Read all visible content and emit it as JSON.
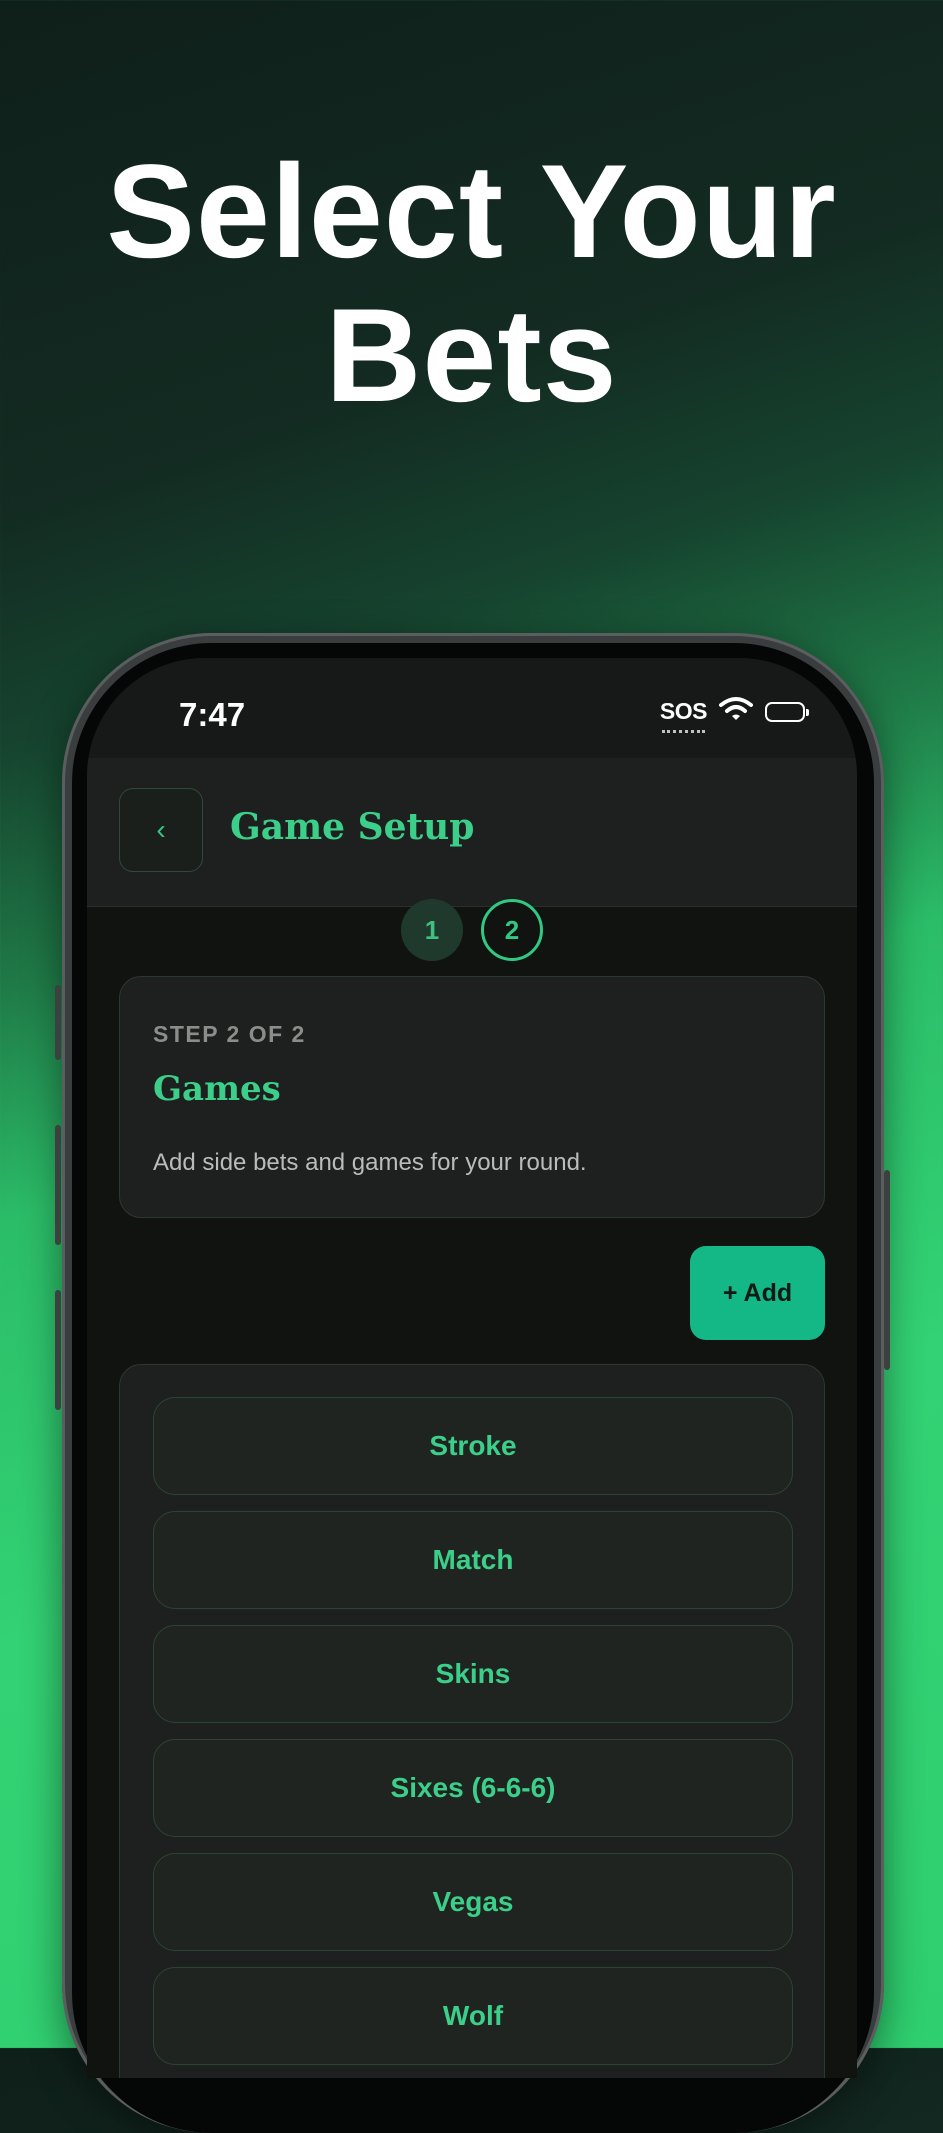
{
  "headline": {
    "line1": "Select Your",
    "line2": "Bets"
  },
  "status_bar": {
    "time": "7:47",
    "sos": "SOS",
    "wifi_icon": "wifi-icon",
    "battery_icon": "battery-icon"
  },
  "app_bar": {
    "back_icon": "chevron-left-icon",
    "back_glyph": "‹",
    "title": "Game Setup"
  },
  "stepper": {
    "steps": [
      "1",
      "2"
    ],
    "active": "2"
  },
  "intro_card": {
    "kicker": "STEP 2 OF 2",
    "title": "Games",
    "description": "Add side bets and games for your round."
  },
  "add_button": {
    "label": "+ Add"
  },
  "games": [
    {
      "label": "Stroke"
    },
    {
      "label": "Match"
    },
    {
      "label": "Skins"
    },
    {
      "label": "Sixes (6-6-6)"
    },
    {
      "label": "Vegas"
    },
    {
      "label": "Wolf"
    }
  ],
  "colors": {
    "accent": "#3ccf8a",
    "button": "#14b887",
    "background_top": "#0f1f1a",
    "background_bottom": "#2fcf6f",
    "surface": "#1d201e"
  }
}
